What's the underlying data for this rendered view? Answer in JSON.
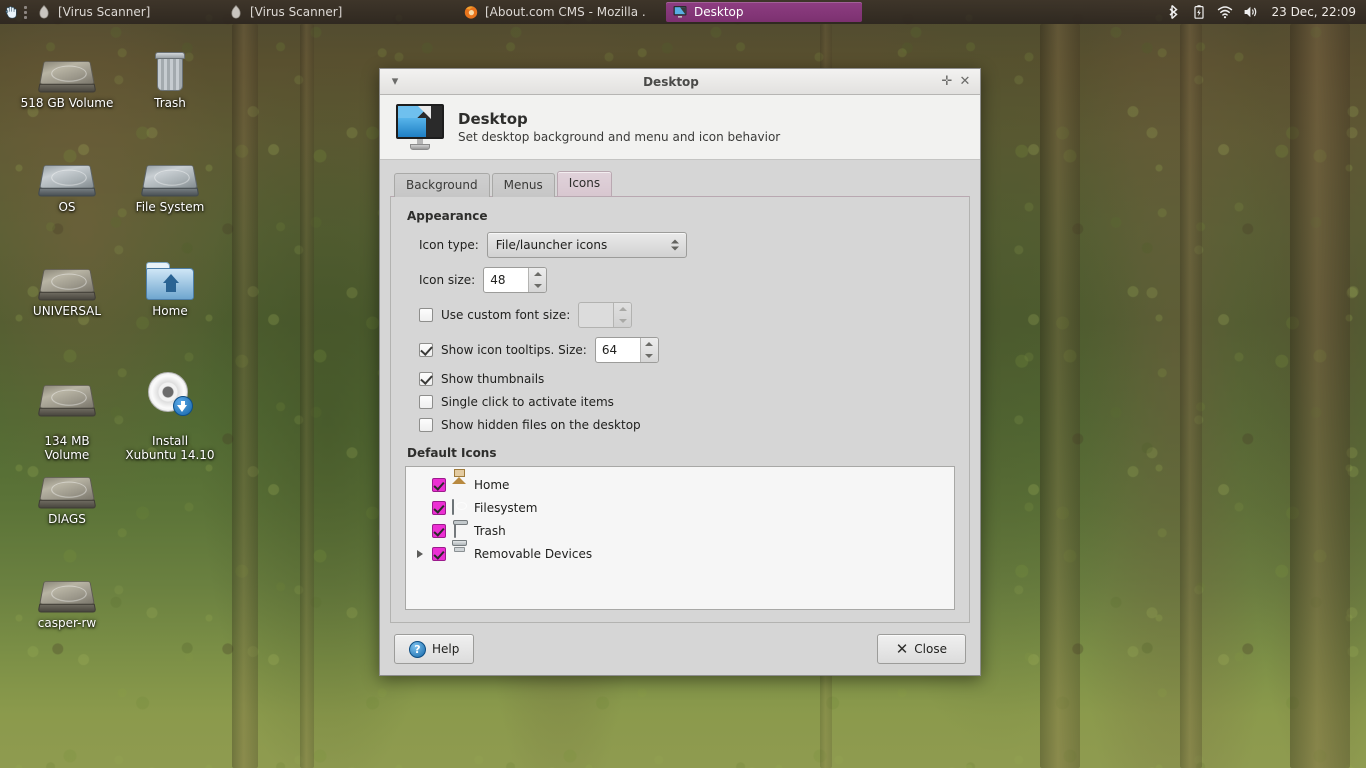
{
  "taskbar": {
    "menu_icon": "whisker-menu-icon",
    "tasks": [
      {
        "label": "[Virus Scanner]",
        "icon": "virus-scanner-icon",
        "active": false
      },
      {
        "label": "[Virus Scanner]",
        "icon": "virus-scanner-icon",
        "active": false
      },
      {
        "label": "[About.com CMS - Mozilla ...",
        "icon": "firefox-icon",
        "active": false
      },
      {
        "label": "Desktop",
        "icon": "desktop-settings-icon",
        "active": true
      }
    ],
    "tray": [
      "bluetooth-icon",
      "battery-icon",
      "wifi-icon",
      "volume-icon"
    ],
    "clock": "23 Dec, 22:09",
    "active_color": "#8e3d82"
  },
  "desktop_icons": [
    {
      "label": "518 GB Volume",
      "icon": "drive-icon"
    },
    {
      "label": "Trash",
      "icon": "trash-icon"
    },
    {
      "label": "OS",
      "icon": "drive-icon"
    },
    {
      "label": "File System",
      "icon": "drive-icon"
    },
    {
      "label": "UNIVERSAL",
      "icon": "drive-icon"
    },
    {
      "label": "Home",
      "icon": "home-folder-icon"
    },
    {
      "label": "134 MB\nVolume",
      "icon": "drive-icon"
    },
    {
      "label": "Install\nXubuntu 14.10",
      "icon": "cd-installer-icon"
    },
    {
      "label": "DIAGS",
      "icon": "drive-icon"
    },
    {
      "label": "casper-rw",
      "icon": "drive-icon"
    }
  ],
  "dialog": {
    "titlebar": {
      "title": "Desktop",
      "menu_icon": "chevron-down-icon",
      "maximize_icon": "plus-icon",
      "close_icon": "close-icon"
    },
    "header": {
      "icon": "desktop-monitor-icon",
      "title": "Desktop",
      "subtitle": "Set desktop background and menu and icon behavior"
    },
    "tabs": [
      {
        "label": "Background",
        "active": false
      },
      {
        "label": "Menus",
        "active": false
      },
      {
        "label": "Icons",
        "active": true
      }
    ],
    "icons_tab": {
      "appearance": {
        "group_label": "Appearance",
        "icon_type_label": "Icon type:",
        "icon_type_value": "File/launcher icons",
        "icon_size_label": "Icon size:",
        "icon_size_value": "48",
        "custom_font_size_label": "Use custom font size:",
        "custom_font_size_checked": false,
        "custom_font_size_value": "",
        "tooltips_label": "Show icon tooltips. Size:",
        "tooltips_checked": true,
        "tooltips_size_value": "64",
        "thumbnails_label": "Show thumbnails",
        "thumbnails_checked": true,
        "single_click_label": "Single click to activate items",
        "single_click_checked": false,
        "hidden_files_label": "Show hidden files on the desktop",
        "hidden_files_checked": false
      },
      "default_icons": {
        "group_label": "Default Icons",
        "checkbox_color": "#ec2fd3",
        "items": [
          {
            "label": "Home",
            "icon": "home-icon",
            "checked": true,
            "expandable": false
          },
          {
            "label": "Filesystem",
            "icon": "filesystem-icon",
            "checked": true,
            "expandable": false
          },
          {
            "label": "Trash",
            "icon": "trash-icon",
            "checked": true,
            "expandable": false
          },
          {
            "label": "Removable Devices",
            "icon": "removable-device-icon",
            "checked": true,
            "expandable": true
          }
        ]
      }
    },
    "footer": {
      "help_label": "Help",
      "help_icon": "help-icon",
      "close_label": "Close",
      "close_icon": "x-icon"
    }
  }
}
